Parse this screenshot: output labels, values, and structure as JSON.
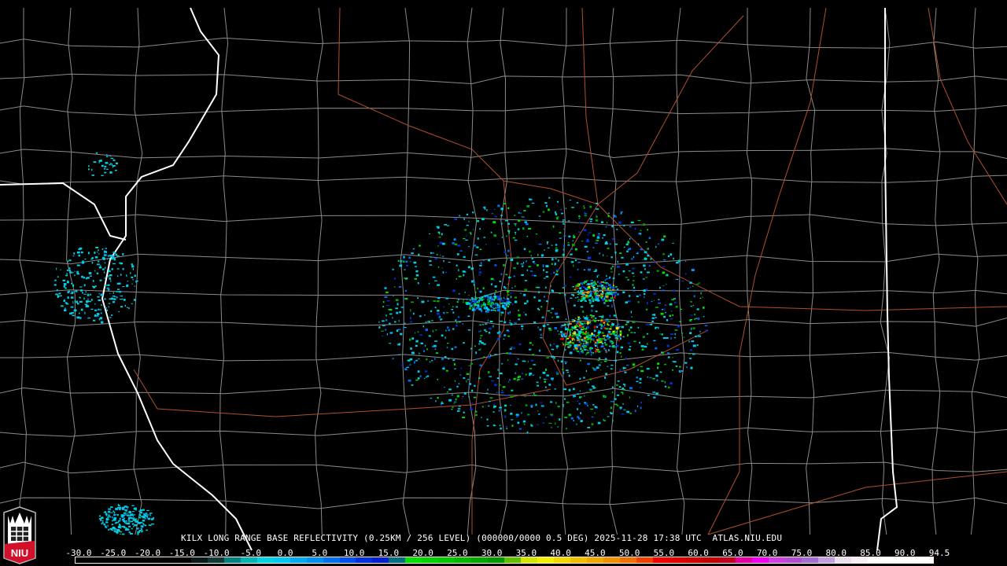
{
  "caption": {
    "radar": "KILX",
    "product": "LONG RANGE BASE REFLECTIVITY",
    "resolution": "(0.25KM / 256 LEVEL)",
    "volume": "(000000/0000 0.5 DEG)",
    "datetime": "2025-11-28 17:38 UTC",
    "site": "ATLAS.NIU.EDU"
  },
  "logo": {
    "text": "NIU"
  },
  "scale": {
    "labels": [
      "-30.0",
      "-25.0",
      "-20.0",
      "-15.0",
      "-10.0",
      "-5.0",
      "0.0",
      "5.0",
      "10.0",
      "15.0",
      "20.0",
      "25.0",
      "30.0",
      "35.0",
      "40.0",
      "45.0",
      "50.0",
      "55.0",
      "60.0",
      "65.0",
      "70.0",
      "75.0",
      "80.0",
      "85.0",
      "90.0",
      "94.5"
    ],
    "colors": [
      "#000000",
      "#000000",
      "#000000",
      "#000000",
      "#000000",
      "#000000",
      "#000000",
      "#0a1a1a",
      "#0f3a3a",
      "#008080",
      "#00b4b4",
      "#00d4e0",
      "#00c8f0",
      "#00aaf0",
      "#0090f0",
      "#0070f0",
      "#0050f0",
      "#0030e0",
      "#0020d0",
      "#006e80",
      "#00e000",
      "#00d400",
      "#00c800",
      "#00b800",
      "#00a800",
      "#009800",
      "#60c000",
      "#d0e800",
      "#f0f000",
      "#f0d800",
      "#f0c000",
      "#f0a800",
      "#f09000",
      "#f07000",
      "#f04000",
      "#f00000",
      "#e00000",
      "#d00000",
      "#c00000",
      "#c00020",
      "#e000a0",
      "#f000f0",
      "#d040e0",
      "#b050d0",
      "#a070d0",
      "#c0a0e0",
      "#e8e0f0",
      "#f4f0f8",
      "#ffffff",
      "#ffffff",
      "#ffffff",
      "#ffffff"
    ]
  }
}
